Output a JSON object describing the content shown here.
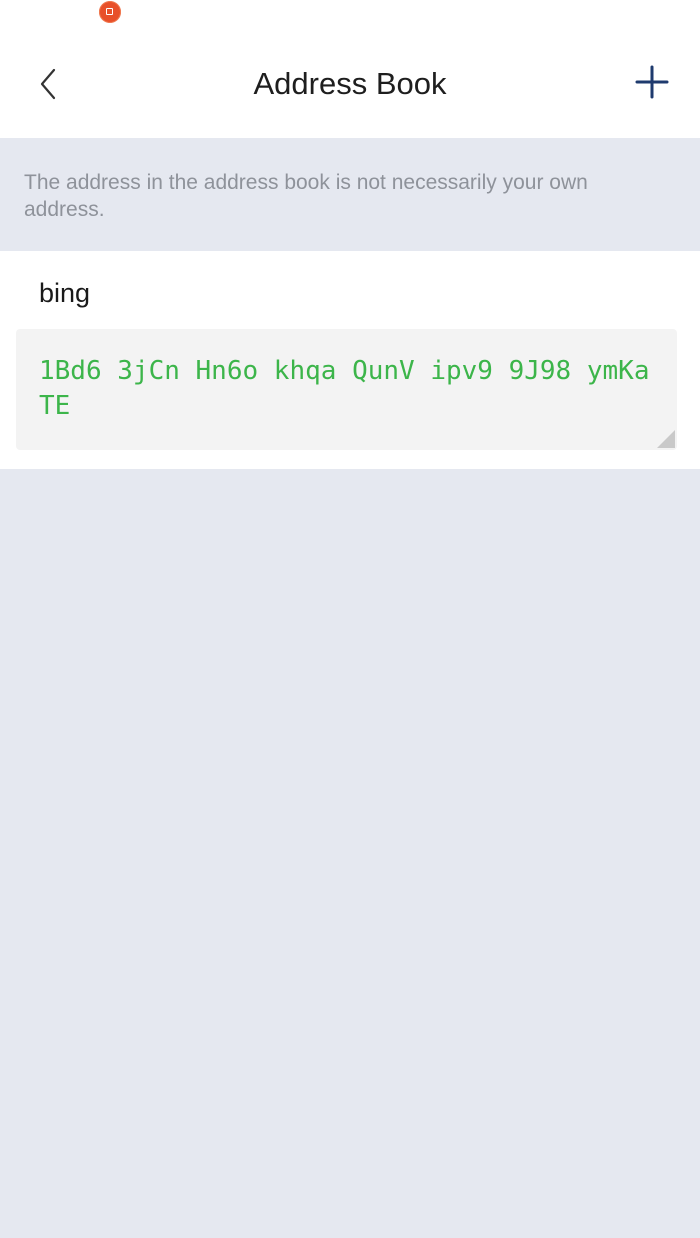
{
  "header": {
    "title": "Address Book",
    "back_icon": "chevron-left-icon",
    "add_icon": "plus-icon",
    "accent_color": "#1E3A6E"
  },
  "notice": {
    "text": "The address in the address book is not necessarily your own address."
  },
  "entries": [
    {
      "name": "bing",
      "address": "1Bd6 3jCn Hn6o khqa QunV ipv9 9J98 ymKa TE",
      "address_color": "#3CB54A"
    }
  ]
}
